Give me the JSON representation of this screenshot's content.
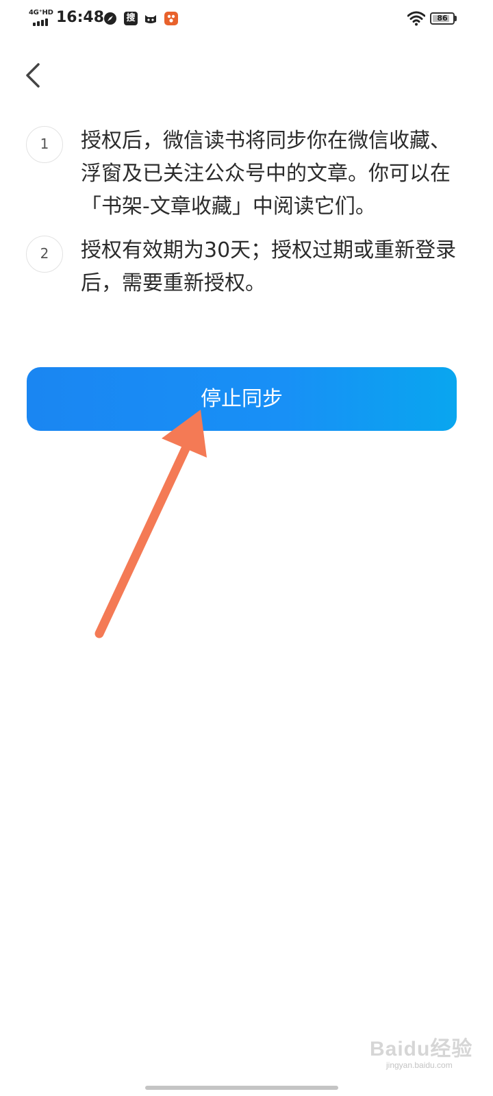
{
  "status_bar": {
    "network_label": "4G⁺HD",
    "time": "16:48",
    "search_app_label": "搜",
    "battery_level": "86",
    "battery_fraction": 0.86,
    "icons": [
      "compass-icon",
      "search-app-icon",
      "cat-icon",
      "app-icon",
      "wifi-icon",
      "battery-icon"
    ]
  },
  "header": {
    "back_icon": "chevron-left-icon"
  },
  "steps": [
    {
      "number": "1",
      "text": "授权后，微信读书将同步你在微信收藏、浮窗及已关注公众号中的文章。你可以在「书架-文章收藏」中阅读它们。"
    },
    {
      "number": "2",
      "text": "授权有效期为30天；授权过期或重新登录后，需要重新授权。"
    }
  ],
  "actions": {
    "stop_sync_label": "停止同步"
  },
  "annotation": {
    "arrow_color": "#f47a55"
  },
  "watermark": {
    "main": "Baidu经验",
    "sub": "jingyan.baidu.com"
  },
  "colors": {
    "button_start": "#1a86f2",
    "button_end": "#09a6ef",
    "text": "#2b2b2b"
  }
}
